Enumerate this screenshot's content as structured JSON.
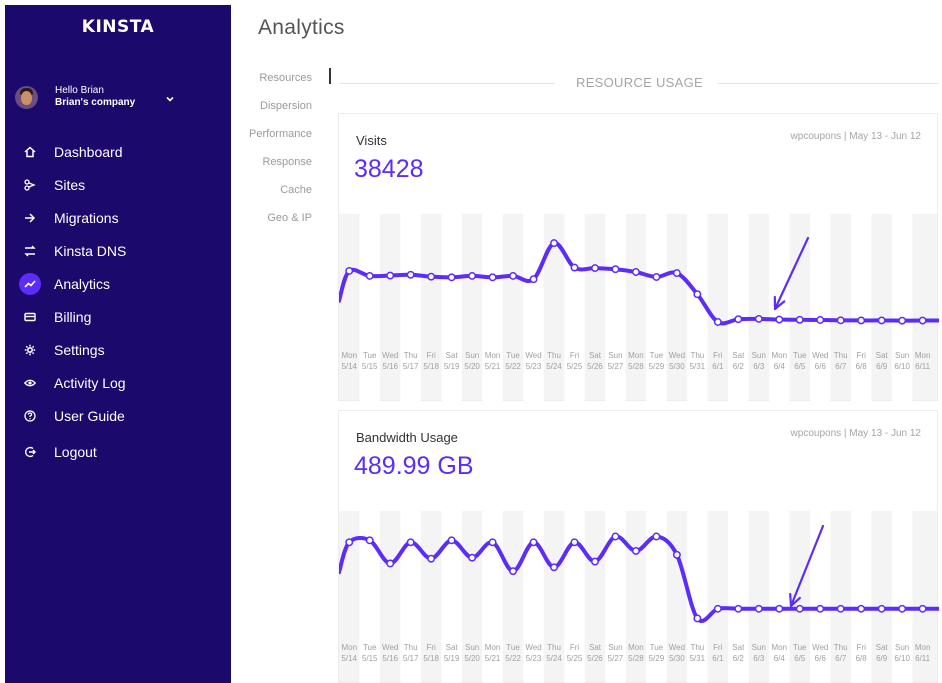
{
  "brand": {
    "logo": "KINSTA"
  },
  "user": {
    "greeting": "Hello Brian",
    "company": "Brian's company"
  },
  "nav": [
    {
      "label": "Dashboard",
      "icon": "home-icon"
    },
    {
      "label": "Sites",
      "icon": "sites-icon"
    },
    {
      "label": "Migrations",
      "icon": "migrations-icon"
    },
    {
      "label": "Kinsta DNS",
      "icon": "dns-icon"
    },
    {
      "label": "Analytics",
      "icon": "analytics-icon",
      "active": true
    },
    {
      "label": "Billing",
      "icon": "billing-icon"
    },
    {
      "label": "Settings",
      "icon": "settings-icon"
    },
    {
      "label": "Activity Log",
      "icon": "eye-icon"
    },
    {
      "label": "User Guide",
      "icon": "question-icon"
    },
    {
      "label": "Logout",
      "icon": "logout-icon"
    }
  ],
  "page": {
    "title": "Analytics",
    "section_title": "RESOURCE USAGE"
  },
  "subnav": [
    "Resources",
    "Dispersion",
    "Performance",
    "Response",
    "Cache",
    "Geo & IP"
  ],
  "colors": {
    "sidebar": "#1b0a6b",
    "accent": "#5b2cfa",
    "plot_bg": "#f4f4f4"
  },
  "chart_data": [
    {
      "type": "line",
      "title": "Visits",
      "value_label": "38428",
      "range_label": "wpcoupons | May 13 - Jun 12",
      "categories": [
        [
          "Mon",
          "5/14"
        ],
        [
          "Tue",
          "5/15"
        ],
        [
          "Wed",
          "5/16"
        ],
        [
          "Thu",
          "5/17"
        ],
        [
          "Fri",
          "5/18"
        ],
        [
          "Sat",
          "5/19"
        ],
        [
          "Sun",
          "5/20"
        ],
        [
          "Mon",
          "5/21"
        ],
        [
          "Tue",
          "5/22"
        ],
        [
          "Wed",
          "5/23"
        ],
        [
          "Thu",
          "5/24"
        ],
        [
          "Fri",
          "5/25"
        ],
        [
          "Sat",
          "5/26"
        ],
        [
          "Sun",
          "5/27"
        ],
        [
          "Mon",
          "5/28"
        ],
        [
          "Tue",
          "5/29"
        ],
        [
          "Wed",
          "5/30"
        ],
        [
          "Thu",
          "5/31"
        ],
        [
          "Fri",
          "6/1"
        ],
        [
          "Sat",
          "6/2"
        ],
        [
          "Sun",
          "6/3"
        ],
        [
          "Mon",
          "6/4"
        ],
        [
          "Tue",
          "6/5"
        ],
        [
          "Wed",
          "6/6"
        ],
        [
          "Thu",
          "6/7"
        ],
        [
          "Fri",
          "6/8"
        ],
        [
          "Sat",
          "6/9"
        ],
        [
          "Sun",
          "6/10"
        ],
        [
          "Mon",
          "6/11"
        ]
      ],
      "values": [
        1450,
        1405,
        1408,
        1415,
        1398,
        1392,
        1405,
        1392,
        1405,
        1375,
        1700,
        1480,
        1475,
        1465,
        1440,
        1395,
        1430,
        1240,
        990,
        1015,
        1018,
        1012,
        1010,
        1008,
        1005,
        1004,
        1004,
        1002,
        1003
      ],
      "ylim": [
        900,
        1800
      ],
      "annotation": "arrow pointing at drop"
    },
    {
      "type": "line",
      "title": "Bandwidth Usage",
      "value_label": "489.99 GB",
      "range_label": "wpcoupons | May 13 - Jun 12",
      "categories": [
        [
          "Mon",
          "5/14"
        ],
        [
          "Tue",
          "5/15"
        ],
        [
          "Wed",
          "5/16"
        ],
        [
          "Thu",
          "5/17"
        ],
        [
          "Fri",
          "5/18"
        ],
        [
          "Sat",
          "5/19"
        ],
        [
          "Sun",
          "5/20"
        ],
        [
          "Mon",
          "5/21"
        ],
        [
          "Tue",
          "5/22"
        ],
        [
          "Wed",
          "5/23"
        ],
        [
          "Thu",
          "5/24"
        ],
        [
          "Fri",
          "5/25"
        ],
        [
          "Sat",
          "5/26"
        ],
        [
          "Sun",
          "5/27"
        ],
        [
          "Mon",
          "5/28"
        ],
        [
          "Tue",
          "5/29"
        ],
        [
          "Wed",
          "5/30"
        ],
        [
          "Thu",
          "5/31"
        ],
        [
          "Fri",
          "6/1"
        ],
        [
          "Sat",
          "6/2"
        ],
        [
          "Sun",
          "6/3"
        ],
        [
          "Mon",
          "6/4"
        ],
        [
          "Tue",
          "6/5"
        ],
        [
          "Wed",
          "6/6"
        ],
        [
          "Thu",
          "6/7"
        ],
        [
          "Fri",
          "6/8"
        ],
        [
          "Sat",
          "6/9"
        ],
        [
          "Sun",
          "6/10"
        ],
        [
          "Mon",
          "6/11"
        ]
      ],
      "values": [
        1700,
        1720,
        1480,
        1700,
        1530,
        1720,
        1540,
        1700,
        1400,
        1700,
        1440,
        1700,
        1500,
        1760,
        1610,
        1760,
        1570,
        910,
        1010,
        1010,
        1010,
        1010,
        1010,
        1010,
        1010,
        1010,
        1010,
        1010,
        1010
      ],
      "ylim": [
        800,
        1900
      ],
      "annotation": "arrow pointing at drop"
    }
  ]
}
